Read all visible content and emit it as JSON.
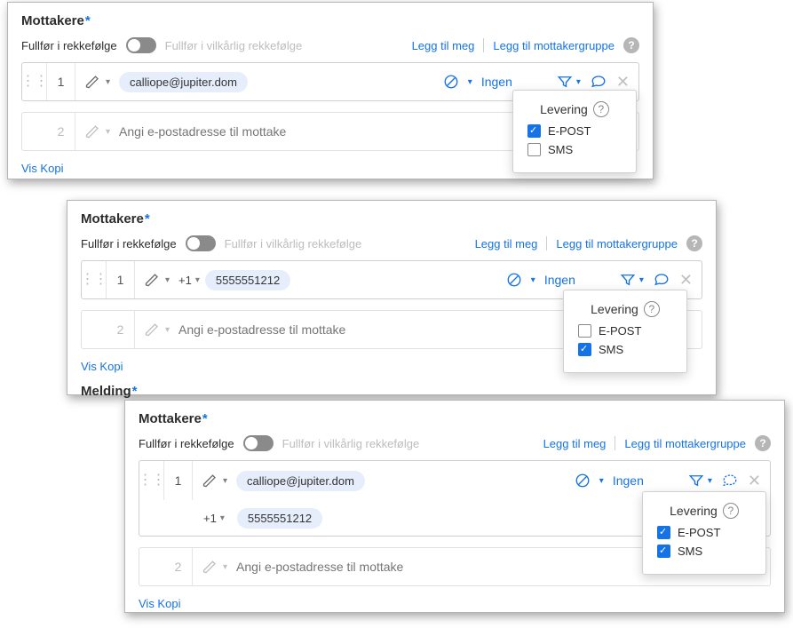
{
  "common": {
    "section_title": "Mottakere",
    "order_seq": "Fullfør i rekkefølge",
    "order_any": "Fullfør i vilkårlig rekkefølge",
    "add_me": "Legg til meg",
    "add_group": "Legg til mottakergruppe",
    "auth_none": "Ingen",
    "placeholder2": "Angi e-postadresse til mottake",
    "show_copy": "Vis Kopi",
    "popover_title": "Levering",
    "epost_label": "E-POST",
    "sms_label": "SMS",
    "prefix": "+1",
    "num1": "1",
    "num2": "2"
  },
  "panel1": {
    "email_chip": "calliope@jupiter.dom",
    "epost_checked": true,
    "sms_checked": false
  },
  "panel2": {
    "phone_chip": "5555551212",
    "epost_checked": false,
    "sms_checked": true,
    "message_title": "Melding"
  },
  "panel3": {
    "email_chip": "calliope@jupiter.dom",
    "phone_chip": "5555551212",
    "epost_checked": true,
    "sms_checked": true
  }
}
